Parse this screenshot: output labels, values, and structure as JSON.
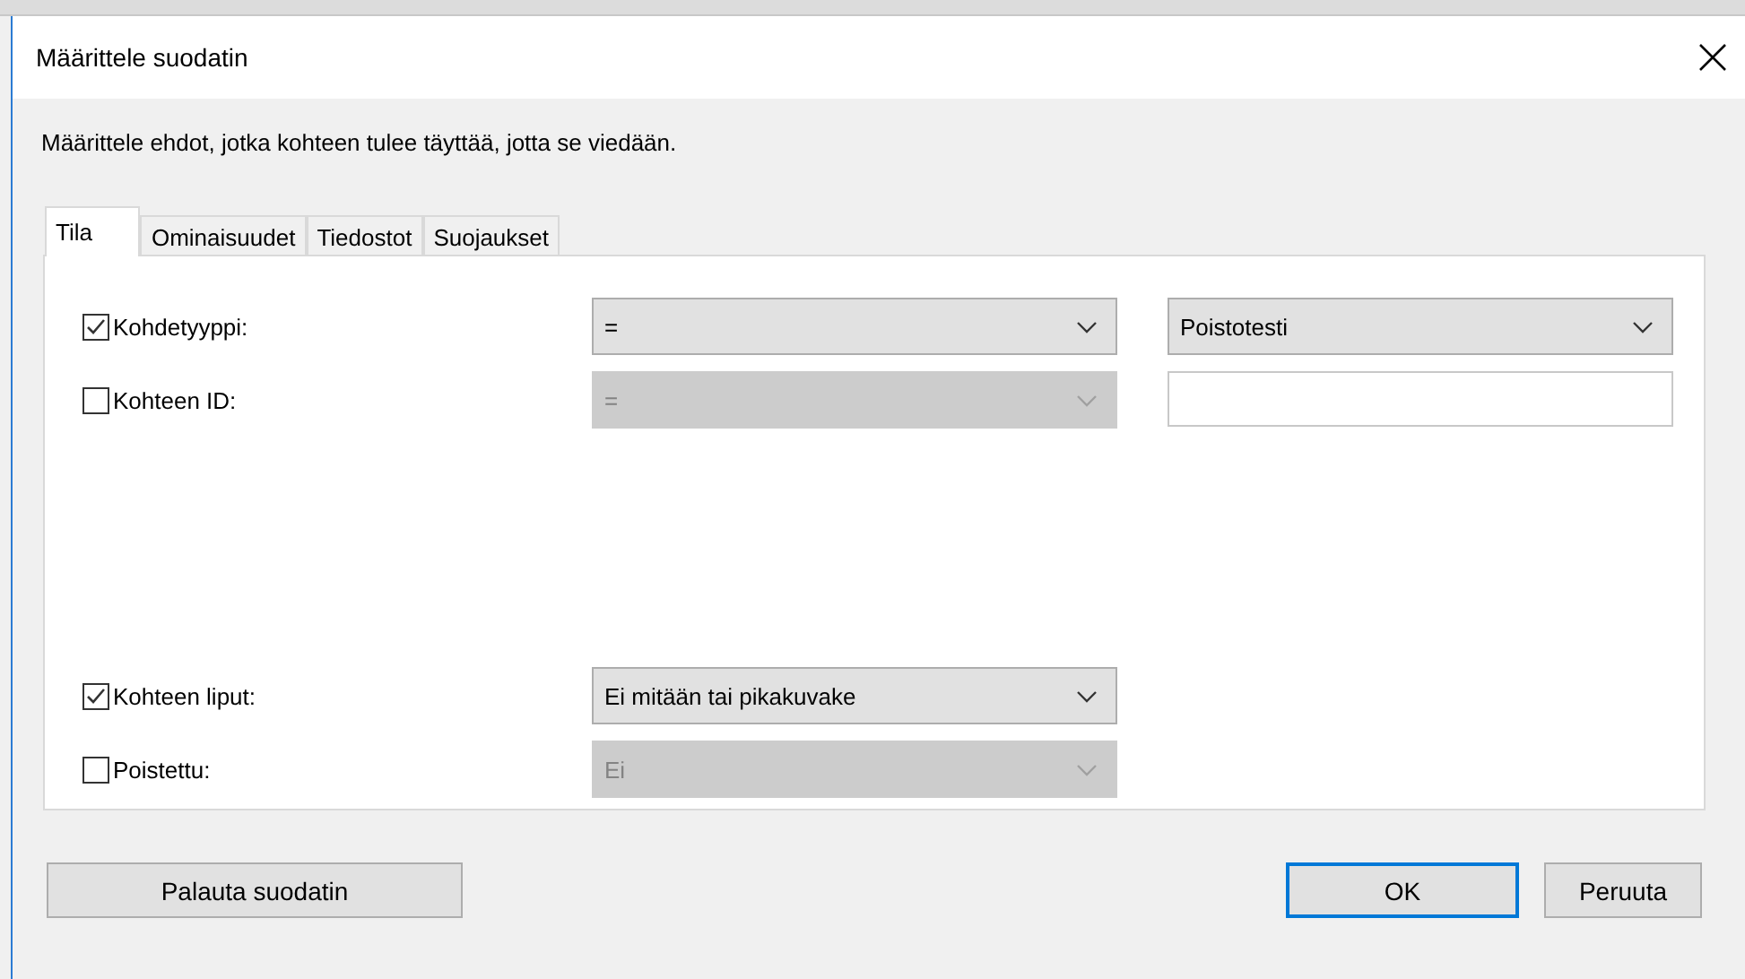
{
  "window": {
    "title": "Määrittele suodatin"
  },
  "instruction": "Määrittele ehdot, jotka kohteen tulee täyttää, jotta se viedään.",
  "tabs": [
    {
      "label": "Tila",
      "selected": true
    },
    {
      "label": "Ominaisuudet",
      "selected": false
    },
    {
      "label": "Tiedostot",
      "selected": false
    },
    {
      "label": "Suojaukset",
      "selected": false
    }
  ],
  "groups": [
    [
      {
        "label": "Kohdetyyppi:",
        "checked": true,
        "operator": {
          "value": "=",
          "disabled": false
        },
        "value": {
          "kind": "dropdown",
          "text": "Poistotesti",
          "disabled": false
        }
      },
      {
        "label": "Kohteen ID:",
        "checked": false,
        "operator": {
          "value": "=",
          "disabled": true
        },
        "value": {
          "kind": "text"
        }
      }
    ],
    [
      {
        "label": "Kohteen liput:",
        "checked": true,
        "operator": {
          "value": "Ei mitään tai pikakuvake",
          "disabled": false
        }
      },
      {
        "label": "Poistettu:",
        "checked": false,
        "operator": {
          "value": "Ei",
          "disabled": true
        }
      }
    ]
  ],
  "buttons": [
    {
      "label": "Palauta suodatin",
      "default": false
    },
    {
      "label": "OK",
      "default": true
    },
    {
      "label": "Peruuta",
      "default": false
    }
  ]
}
